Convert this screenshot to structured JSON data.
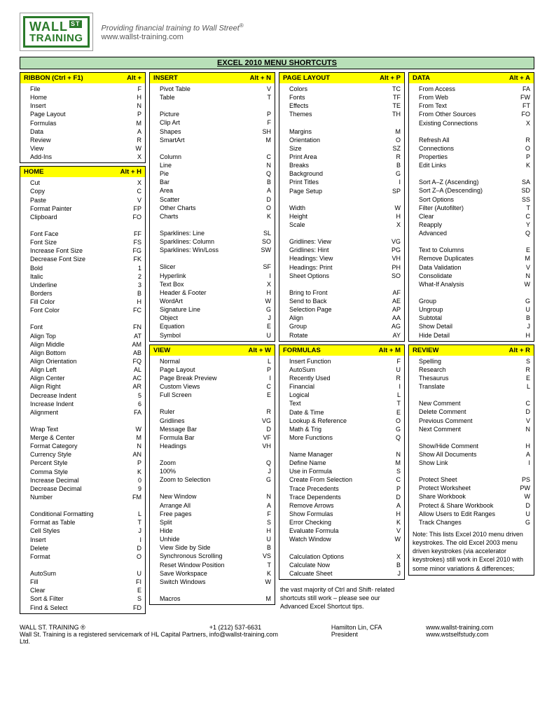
{
  "header": {
    "logo_top": "WALL",
    "logo_st": "ST",
    "logo_bottom": "TRAINING",
    "tagline": "Providing financial training to Wall Street",
    "url": "www.wallst-training.com"
  },
  "title": "EXCEL 2010 MENU SHORTCUTS",
  "sections": {
    "ribbon": {
      "title": "RIBBON (Ctrl + F1)",
      "key": "Alt +",
      "rows": [
        [
          "File",
          "F"
        ],
        [
          "Home",
          "H"
        ],
        [
          "Insert",
          "N"
        ],
        [
          "Page Layout",
          "P"
        ],
        [
          "Formulas",
          "M"
        ],
        [
          "Data",
          "A"
        ],
        [
          "Review",
          "R"
        ],
        [
          "View",
          "W"
        ],
        [
          "Add-Ins",
          "X"
        ]
      ]
    },
    "home": {
      "title": "HOME",
      "key": "Alt + H",
      "rows": [
        [
          "Cut",
          "X"
        ],
        [
          "Copy",
          "C"
        ],
        [
          "Paste",
          "V"
        ],
        [
          "Format Painter",
          "FP"
        ],
        [
          "Clipboard",
          "FO"
        ],
        [
          "",
          ""
        ],
        [
          "Font Face",
          "FF"
        ],
        [
          "Font Size",
          "FS"
        ],
        [
          "Increase Font Size",
          "FG"
        ],
        [
          "Decrease Font Size",
          "FK"
        ],
        [
          "Bold",
          "1"
        ],
        [
          "Italic",
          "2"
        ],
        [
          "Underline",
          "3"
        ],
        [
          "Borders",
          "B"
        ],
        [
          "Fill Color",
          "H"
        ],
        [
          "Font Color",
          "FC"
        ],
        [
          "",
          ""
        ],
        [
          "Font",
          "FN"
        ],
        [
          "Align Top",
          "AT"
        ],
        [
          "Align Middle",
          "AM"
        ],
        [
          "Align Bottom",
          "AB"
        ],
        [
          "Align Orientation",
          "FQ"
        ],
        [
          "Align Left",
          "AL"
        ],
        [
          "Align Center",
          "AC"
        ],
        [
          "Align Right",
          "AR"
        ],
        [
          "Decrease Indent",
          "5"
        ],
        [
          "Increase Indent",
          "6"
        ],
        [
          "Alignment",
          "FA"
        ],
        [
          "",
          ""
        ],
        [
          "Wrap Text",
          "W"
        ],
        [
          "Merge & Center",
          "M"
        ],
        [
          "Format Category",
          "N"
        ],
        [
          "Currency Style",
          "AN"
        ],
        [
          "Percent Style",
          "P"
        ],
        [
          "Comma Style",
          "K"
        ],
        [
          "Increase Decimal",
          "0"
        ],
        [
          "Decrease Decimal",
          "9"
        ],
        [
          "Number",
          "FM"
        ],
        [
          "",
          ""
        ],
        [
          "Conditional Formatting",
          "L"
        ],
        [
          "Format as Table",
          "T"
        ],
        [
          "Cell Styles",
          "J"
        ],
        [
          "Insert",
          "I"
        ],
        [
          "Delete",
          "D"
        ],
        [
          "Format",
          "O"
        ],
        [
          "",
          ""
        ],
        [
          "AutoSum",
          "U"
        ],
        [
          "Fill",
          "FI"
        ],
        [
          "Clear",
          "E"
        ],
        [
          "Sort & Filter",
          "S"
        ],
        [
          "Find & Select",
          "FD"
        ]
      ]
    },
    "insert": {
      "title": "INSERT",
      "key": "Alt + N",
      "rows": [
        [
          "Pivot Table",
          "V"
        ],
        [
          "Table",
          "T"
        ],
        [
          "",
          ""
        ],
        [
          "Picture",
          "P"
        ],
        [
          "Clip Art",
          "F"
        ],
        [
          "Shapes",
          "SH"
        ],
        [
          "SmartArt",
          "M"
        ],
        [
          "",
          ""
        ],
        [
          "Column",
          "C"
        ],
        [
          "Line",
          "N"
        ],
        [
          "Pie",
          "Q"
        ],
        [
          "Bar",
          "B"
        ],
        [
          "Area",
          "A"
        ],
        [
          "Scatter",
          "D"
        ],
        [
          "Other Charts",
          "O"
        ],
        [
          "Charts",
          "K"
        ],
        [
          "",
          ""
        ],
        [
          "Sparklines: Line",
          "SL"
        ],
        [
          "Sparklines: Column",
          "SO"
        ],
        [
          "Sparklines: Win/Loss",
          "SW"
        ],
        [
          "",
          ""
        ],
        [
          "Slicer",
          "SF"
        ],
        [
          "Hyperlink",
          "I"
        ],
        [
          "Text Box",
          "X"
        ],
        [
          "Header & Footer",
          "H"
        ],
        [
          "WordArt",
          "W"
        ],
        [
          "Signature Line",
          "G"
        ],
        [
          "Object",
          "J"
        ],
        [
          "Equation",
          "E"
        ],
        [
          "Symbol",
          "U"
        ]
      ]
    },
    "view": {
      "title": "VIEW",
      "key": "Alt + W",
      "rows": [
        [
          "Normal",
          "L"
        ],
        [
          "Page Layout",
          "P"
        ],
        [
          "Page Break Preview",
          "I"
        ],
        [
          "Custom Views",
          "C"
        ],
        [
          "Full Screen",
          "E"
        ],
        [
          "",
          ""
        ],
        [
          "Ruler",
          "R"
        ],
        [
          "Gridlines",
          "VG"
        ],
        [
          "Message Bar",
          "D"
        ],
        [
          "Formula Bar",
          "VF"
        ],
        [
          "Headings",
          "VH"
        ],
        [
          "",
          ""
        ],
        [
          "Zoom",
          "Q"
        ],
        [
          "100%",
          "J"
        ],
        [
          "Zoom to Selection",
          "G"
        ],
        [
          "",
          ""
        ],
        [
          "New Window",
          "N"
        ],
        [
          "Arrange All",
          "A"
        ],
        [
          "Free pages",
          "F"
        ],
        [
          "Split",
          "S"
        ],
        [
          "Hide",
          "H"
        ],
        [
          "Unhide",
          "U"
        ],
        [
          "View Side by Side",
          "B"
        ],
        [
          "Synchronous Scrolling",
          "VS"
        ],
        [
          "Reset Window Position",
          "T"
        ],
        [
          "Save Workspace",
          "K"
        ],
        [
          "Switch Windows",
          "W"
        ],
        [
          "",
          ""
        ],
        [
          "Macros",
          "M"
        ]
      ]
    },
    "pagelayout": {
      "title": "PAGE LAYOUT",
      "key": "Alt + P",
      "rows": [
        [
          "Colors",
          "TC"
        ],
        [
          "Fonts",
          "TF"
        ],
        [
          "Effects",
          "TE"
        ],
        [
          "Themes",
          "TH"
        ],
        [
          "",
          ""
        ],
        [
          "Margins",
          "M"
        ],
        [
          "Orientation",
          "O"
        ],
        [
          "Size",
          "SZ"
        ],
        [
          "Print Area",
          "R"
        ],
        [
          "Breaks",
          "B"
        ],
        [
          "Background",
          "G"
        ],
        [
          "Print Titles",
          "I"
        ],
        [
          "Page Setup",
          "SP"
        ],
        [
          "",
          ""
        ],
        [
          "Width",
          "W"
        ],
        [
          "Height",
          "H"
        ],
        [
          "Scale",
          "X"
        ],
        [
          "",
          ""
        ],
        [
          "Gridlines: View",
          "VG"
        ],
        [
          "Gridlines: Hint",
          "PG"
        ],
        [
          "Headings: View",
          "VH"
        ],
        [
          "Headings: Print",
          "PH"
        ],
        [
          "Sheet Options",
          "SO"
        ],
        [
          "",
          ""
        ],
        [
          "Bring to Front",
          "AF"
        ],
        [
          "Send to Back",
          "AE"
        ],
        [
          "Selection Page",
          "AP"
        ],
        [
          "Align",
          "AA"
        ],
        [
          "Group",
          "AG"
        ],
        [
          "Rotate",
          "AY"
        ]
      ]
    },
    "formulas": {
      "title": "FORMULAS",
      "key": "Alt + M",
      "rows": [
        [
          "Insert Function",
          "F"
        ],
        [
          "AutoSum",
          "U"
        ],
        [
          "Recently Used",
          "R"
        ],
        [
          "Financial",
          "I"
        ],
        [
          "Logical",
          "L"
        ],
        [
          "Text",
          "T"
        ],
        [
          "Date & Time",
          "E"
        ],
        [
          "Lookup & Reference",
          "O"
        ],
        [
          "Math & Trig",
          "G"
        ],
        [
          "More Functions",
          "Q"
        ],
        [
          "",
          ""
        ],
        [
          "Name Manager",
          "N"
        ],
        [
          "Define Name",
          "M"
        ],
        [
          "Use in Formula",
          "S"
        ],
        [
          "Create From Selection",
          "C"
        ],
        [
          "Trace Precedents",
          "P"
        ],
        [
          "Trace Dependents",
          "D"
        ],
        [
          "Remove Arrows",
          "A"
        ],
        [
          "Show Formulas",
          "H"
        ],
        [
          "Error Checking",
          "K"
        ],
        [
          "Evaluate Formula",
          "V"
        ],
        [
          "Watch Window",
          "W"
        ],
        [
          "",
          ""
        ],
        [
          "Calculation Options",
          "X"
        ],
        [
          "Calculate Now",
          "B"
        ],
        [
          "Calcuate Sheet",
          "J"
        ]
      ]
    },
    "data": {
      "title": "DATA",
      "key": "Alt + A",
      "rows": [
        [
          "From Access",
          "FA"
        ],
        [
          "From Web",
          "FW"
        ],
        [
          "From Text",
          "FT"
        ],
        [
          "From Other Sources",
          "FO"
        ],
        [
          "Existing Connections",
          "X"
        ],
        [
          "",
          ""
        ],
        [
          "Refresh All",
          "R"
        ],
        [
          "Connections",
          "O"
        ],
        [
          "Properties",
          "P"
        ],
        [
          "Edit Links",
          "K"
        ],
        [
          "",
          ""
        ],
        [
          "Sort A–Z (Ascending)",
          "SA"
        ],
        [
          "Sort Z–A (Descending)",
          "SD"
        ],
        [
          "Sort Options",
          "SS"
        ],
        [
          "Filter (Autofilter)",
          "T"
        ],
        [
          "Clear",
          "C"
        ],
        [
          "Reapply",
          "Y"
        ],
        [
          "Advanced",
          "Q"
        ],
        [
          "",
          ""
        ],
        [
          "Text to Columns",
          "E"
        ],
        [
          "Remove Duplicates",
          "M"
        ],
        [
          "Data Validation",
          "V"
        ],
        [
          "Consolidate",
          "N"
        ],
        [
          "What-If Analysis",
          "W"
        ],
        [
          "",
          ""
        ],
        [
          "Group",
          "G"
        ],
        [
          "Ungroup",
          "U"
        ],
        [
          "Subtotal",
          "B"
        ],
        [
          "Show Detail",
          "J"
        ],
        [
          "Hide Detail",
          "H"
        ]
      ]
    },
    "review": {
      "title": "REVIEW",
      "key": "Alt + R",
      "rows": [
        [
          "Spelling",
          "S"
        ],
        [
          "Research",
          "R"
        ],
        [
          "Thesaurus",
          "E"
        ],
        [
          "Translate",
          "L"
        ],
        [
          "",
          ""
        ],
        [
          "New Comment",
          "C"
        ],
        [
          "Delete Comment",
          "D"
        ],
        [
          "Previous Comment",
          "V"
        ],
        [
          "Next Comment",
          "N"
        ],
        [
          "",
          ""
        ],
        [
          "Show/Hide Comment",
          "H"
        ],
        [
          "Show All Documents",
          "A"
        ],
        [
          "Show Link",
          "I"
        ],
        [
          "",
          ""
        ],
        [
          "Protect Sheet",
          "PS"
        ],
        [
          "Protect Worksheet",
          "PW"
        ],
        [
          "Share Workbook",
          "W"
        ],
        [
          "Protect & Share Workbook",
          "D"
        ],
        [
          "Allow Users to Edit Ranges",
          "U"
        ],
        [
          "Track Changes",
          "G"
        ]
      ],
      "note": "Note: This lists Excel 2010 menu driven keystrokes. The old Excel 2003 menu driven keystrokes (via accelerator keystrokes) still work in Excel 2010 with some minor variations & differences;"
    }
  },
  "bottom_note": "the vast majority of Ctrl and Shift- related shortcuts still work – please see our Advanced Excel Shortcut tips.",
  "footer": {
    "l1": "WALL ST. TRAINING ®",
    "l2": "Wall St. Training is a registered servicemark of HL Capital Partners, Ltd.",
    "m1": "+1 (212) 537-6631",
    "m2": "info@wallst-training.com",
    "n1": "Hamilton Lin, CFA",
    "n2": "President",
    "r1": "www.wallst-training.com",
    "r2": "www.wstselfstudy.com"
  }
}
